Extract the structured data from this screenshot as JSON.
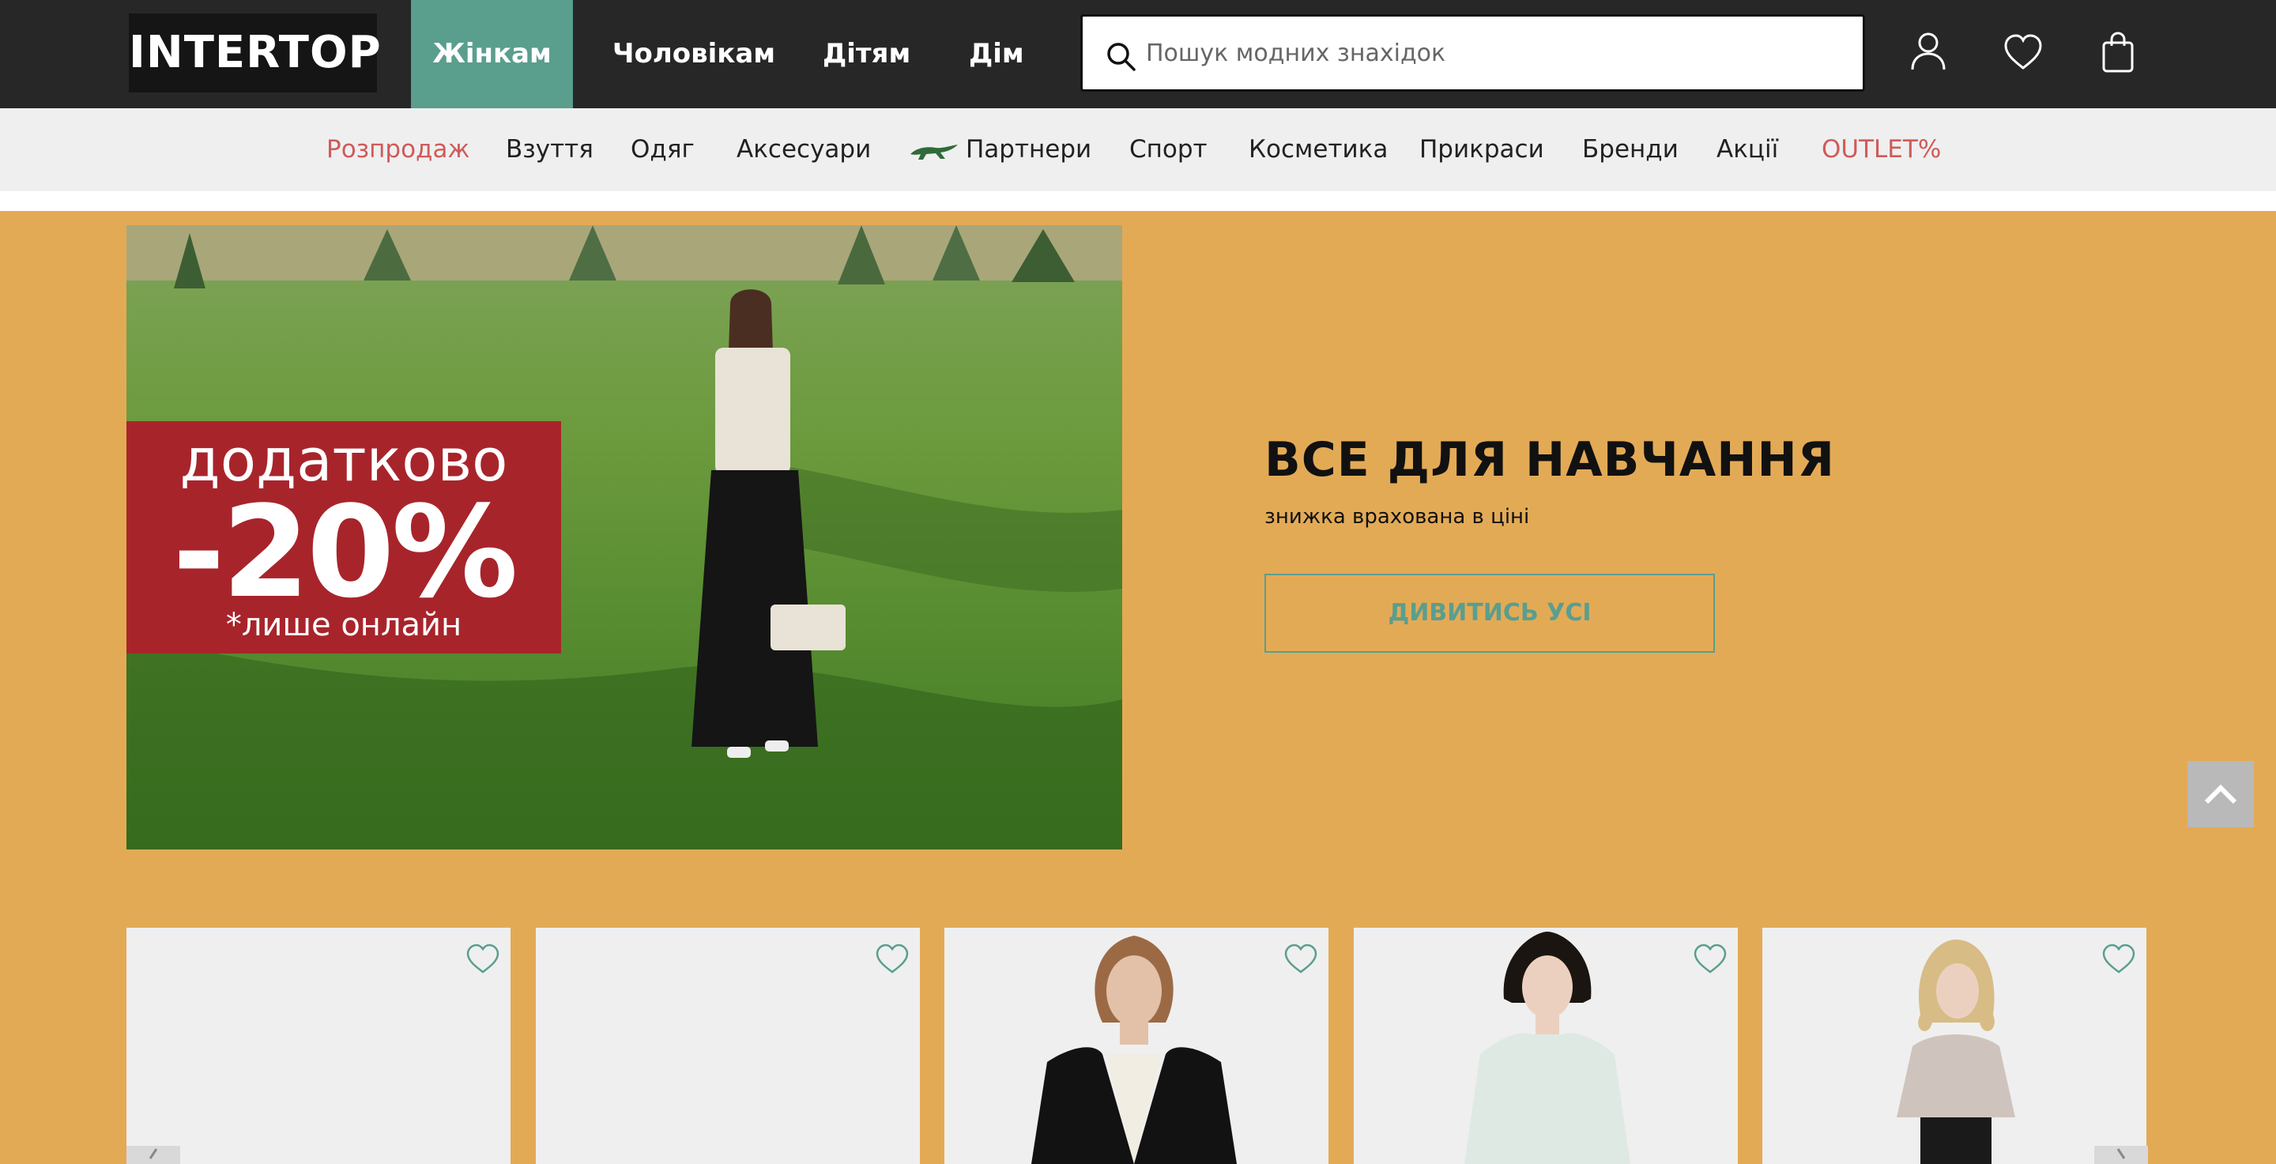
{
  "header": {
    "logo": "INTERTOP",
    "gender_nav": [
      "Жінкам",
      "Чоловікам",
      "Дітям",
      "Дім"
    ],
    "active_gender": "Жінкам",
    "search_placeholder": "Пошук модних знахідок",
    "icons": [
      "user-icon",
      "heart-icon",
      "shopping-bag-icon"
    ],
    "accent_color": "#5a9e8e"
  },
  "categories": [
    {
      "label": "Розпродаж",
      "color": "#d05a5a"
    },
    {
      "label": "Взуття"
    },
    {
      "label": "Одяг"
    },
    {
      "label": "Аксесуари"
    },
    {
      "label": "Партнери",
      "icon": "lacoste-crocodile-icon"
    },
    {
      "label": "Спорт"
    },
    {
      "label": "Косметика"
    },
    {
      "label": "Прикраси"
    },
    {
      "label": "Бренди"
    },
    {
      "label": "Акції"
    },
    {
      "label": "OUTLET%",
      "color": "#d05a5a"
    }
  ],
  "promo": {
    "badge_line1": "додатково",
    "badge_line2": "-20%",
    "badge_line3": "*лише онлайн",
    "title": "ВСЕ ДЛЯ НАВЧАННЯ",
    "subtitle": "знижка врахована в ціні",
    "button": "ДИВИТИСЬ УСІ",
    "background": "#e3aa56",
    "badge_color": "#a8242b"
  },
  "products": [
    {
      "image": "empty"
    },
    {
      "image": "empty"
    },
    {
      "image": "woman-black-blazer"
    },
    {
      "image": "woman-white-shirt"
    },
    {
      "image": "woman-grey-top"
    }
  ]
}
